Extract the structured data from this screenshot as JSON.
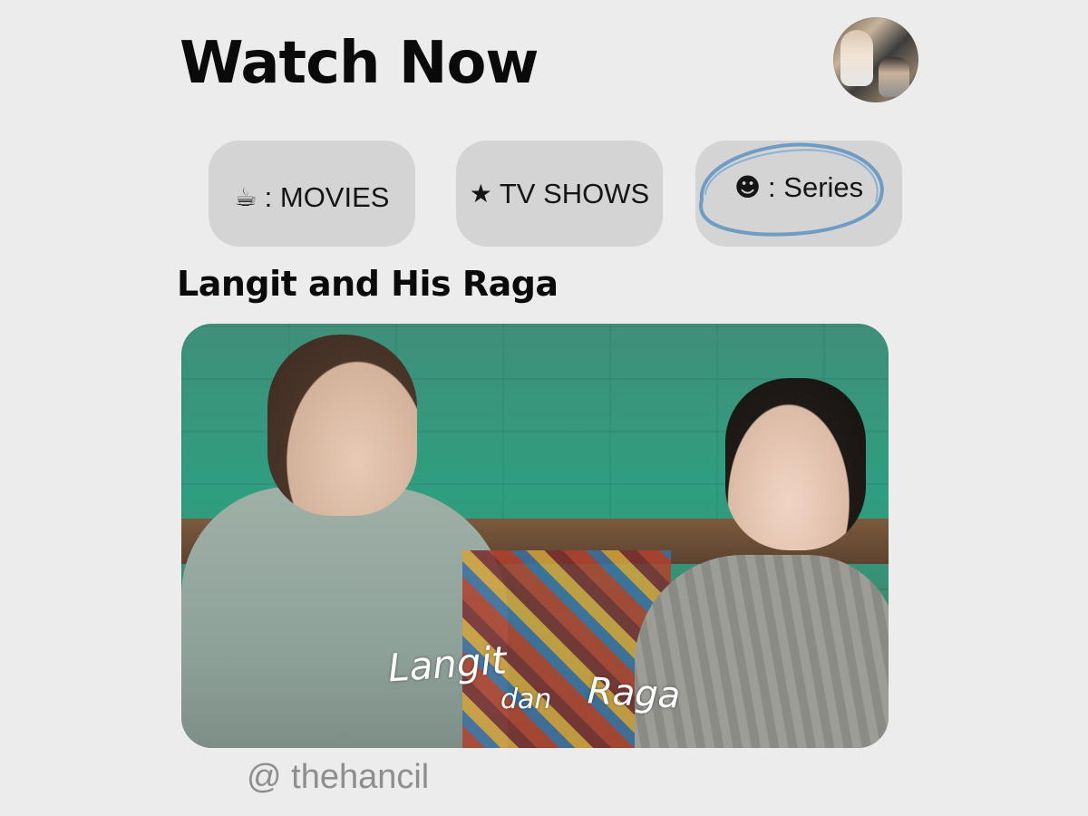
{
  "header": {
    "title": "Watch Now",
    "avatar_icon": "profile-avatar"
  },
  "tabs": [
    {
      "icon": "☕",
      "icon_name": "coffee-cup-icon",
      "label": ": MOVIES"
    },
    {
      "icon": "★",
      "icon_name": "star-icon",
      "label": "TV SHOWS"
    },
    {
      "icon": "☻",
      "icon_name": "smiley-icon",
      "label": ": Series",
      "selected": true
    }
  ],
  "highlight_color": "#6f9cc4",
  "section": {
    "title": "Langit and His Raga",
    "poster": {
      "caption_1": "Langit",
      "caption_2": "dan",
      "caption_3": "Raga"
    }
  },
  "footer": {
    "watermark": "@ thehancil"
  }
}
